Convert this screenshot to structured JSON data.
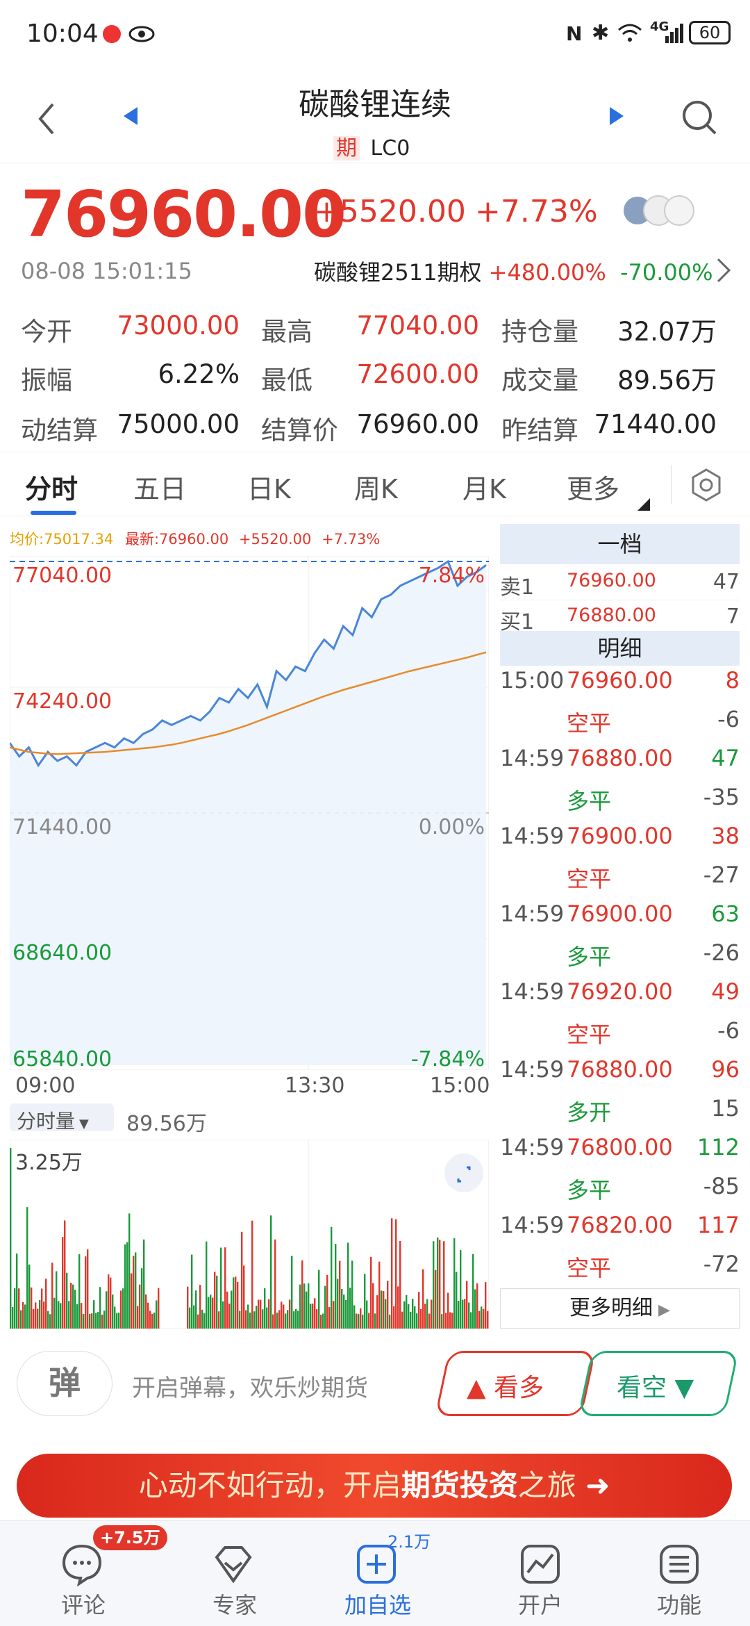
{
  "status": {
    "time": "10:04",
    "battery": "60",
    "net": "4G"
  },
  "header": {
    "title": "碳酸锂连续",
    "badge": "期",
    "code": "LC0"
  },
  "quote": {
    "price": "76960.00",
    "change": "+5520.00",
    "pct": "+7.73%",
    "datetime": "08-08 15:01:15",
    "option_name": "碳酸锂2511期权",
    "option_up": "+480.00%",
    "option_down": "-70.00%"
  },
  "stats": [
    {
      "l": "今开",
      "v": "73000.00",
      "c": "red"
    },
    {
      "l": "最高",
      "v": "77040.00",
      "c": "red"
    },
    {
      "l": "持仓量",
      "v": "32.07万",
      "c": "black"
    },
    {
      "l": "振幅",
      "v": "6.22%",
      "c": "black"
    },
    {
      "l": "最低",
      "v": "72600.00",
      "c": "red"
    },
    {
      "l": "成交量",
      "v": "89.56万",
      "c": "black"
    },
    {
      "l": "动结算",
      "v": "75000.00",
      "c": "black"
    },
    {
      "l": "结算价",
      "v": "76960.00",
      "c": "black"
    },
    {
      "l": "昨结算",
      "v": "71440.00",
      "c": "black"
    }
  ],
  "tabs": [
    "分时",
    "五日",
    "日K",
    "周K",
    "月K",
    "更多"
  ],
  "chart_info": {
    "avg": "均价:75017.34",
    "latest": "最新:76960.00",
    "chg": "+5520.00",
    "pct": "+7.73%"
  },
  "chart_data": {
    "type": "line",
    "y_labels": [
      "77040.00",
      "74240.00",
      "71440.00",
      "68640.00",
      "65840.00"
    ],
    "pct_labels": [
      "7.84%",
      "0.00%",
      "-7.84%"
    ],
    "x_labels": [
      "09:00",
      "13:30",
      "15:00"
    ],
    "ylim": [
      65840,
      77040
    ],
    "series": [
      {
        "values": [
          73000,
          72700,
          72900,
          72500,
          72800,
          72600,
          72700,
          72500,
          72800,
          72900,
          73000,
          72900,
          73100,
          73000,
          73200,
          73300,
          73500,
          73400,
          73500,
          73600,
          73500,
          73700,
          74000,
          73900,
          74200,
          74000,
          74300,
          73800,
          74600,
          74400,
          74700,
          74600,
          75000,
          75300,
          75100,
          75600,
          75400,
          76000,
          75800,
          76200,
          76300,
          76500,
          76600,
          76700,
          76800,
          76900,
          77040,
          76500,
          76700,
          76800,
          76960
        ]
      },
      {
        "values": [
          72900,
          72850,
          72800,
          72780,
          72760,
          72750,
          72760,
          72770,
          72780,
          72790,
          72800,
          72820,
          72840,
          72860,
          72880,
          72900,
          72930,
          72960,
          73000,
          73050,
          73100,
          73150,
          73200,
          73260,
          73330,
          73400,
          73480,
          73560,
          73640,
          73720,
          73800,
          73880,
          73960,
          74040,
          74110,
          74180,
          74240,
          74300,
          74360,
          74420,
          74480,
          74540,
          74600,
          74650,
          74700,
          74750,
          74800,
          74850,
          74900,
          74960,
          75017
        ]
      }
    ]
  },
  "vol": {
    "btn": "分时量",
    "total": "89.56万",
    "max": "3.25万"
  },
  "orderbook": {
    "head": "一档",
    "sell_l": "卖1",
    "sell_p": "76960.00",
    "sell_v": "47",
    "buy_l": "买1",
    "buy_p": "76880.00",
    "buy_v": "7",
    "detail_head": "明细",
    "more": "更多明细"
  },
  "ticks": [
    {
      "t": "15:00",
      "p": "76960.00",
      "v": "8",
      "vc": "red",
      "type": "空平",
      "d": "-6"
    },
    {
      "t": "14:59",
      "p": "76880.00",
      "v": "47",
      "vc": "green",
      "type": "多平",
      "d": "-35"
    },
    {
      "t": "14:59",
      "p": "76900.00",
      "v": "38",
      "vc": "red",
      "type": "空平",
      "d": "-27"
    },
    {
      "t": "14:59",
      "p": "76900.00",
      "v": "63",
      "vc": "green",
      "type": "多平",
      "d": "-26"
    },
    {
      "t": "14:59",
      "p": "76920.00",
      "v": "49",
      "vc": "red",
      "type": "空平",
      "d": "-6"
    },
    {
      "t": "14:59",
      "p": "76880.00",
      "v": "96",
      "vc": "red",
      "type": "多开",
      "d": "15"
    },
    {
      "t": "14:59",
      "p": "76800.00",
      "v": "112",
      "vc": "green",
      "type": "多平",
      "d": "-85"
    },
    {
      "t": "14:59",
      "p": "76820.00",
      "v": "117",
      "vc": "red",
      "type": "空平",
      "d": "-72"
    }
  ],
  "bottom": {
    "danmu": "弹",
    "danmu_text": "开启弹幕，欢乐炒期货",
    "bull": "看多",
    "bear": "看空",
    "banner_a": "心动不如行动，开启",
    "banner_b": "期货投资",
    "banner_c": "之旅"
  },
  "nav": [
    {
      "label": "评论",
      "badge": "+7.5万"
    },
    {
      "label": "专家"
    },
    {
      "label": "加自选",
      "badge": "2.1万"
    },
    {
      "label": "开户"
    },
    {
      "label": "功能"
    }
  ]
}
